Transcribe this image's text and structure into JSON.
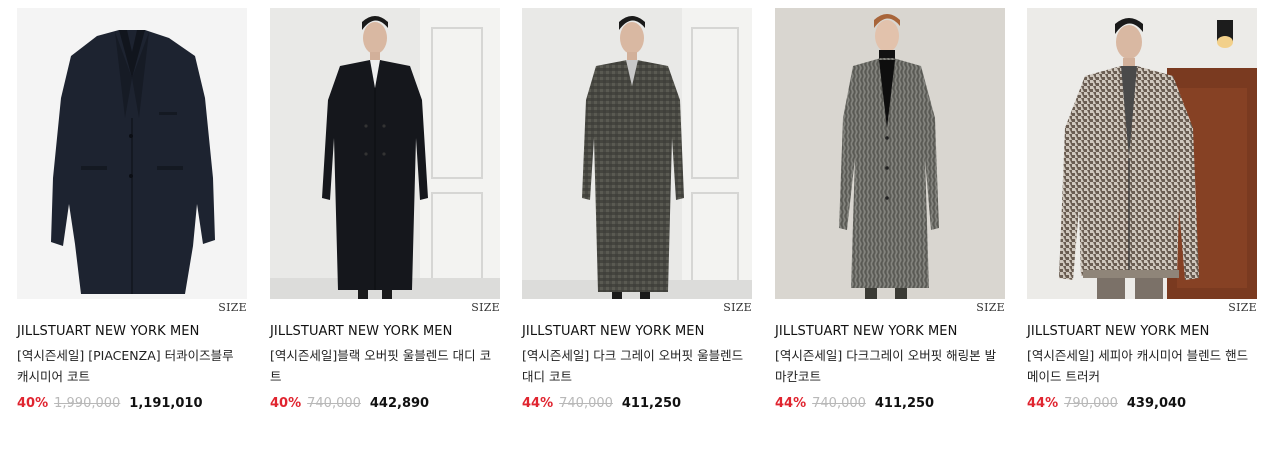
{
  "products": [
    {
      "brand": "JILLSTUART NEW YORK MEN",
      "name": "[역시즌세일] [PIACENZA] 터콰이즈블루 캐시미어 코트",
      "size_label": "SIZE",
      "discount": "40%",
      "original_price": "1,990,000",
      "sale_price": "1,191,010",
      "image": "navy-cashmere-coat-flat"
    },
    {
      "brand": "JILLSTUART NEW YORK MEN",
      "name": "[역시즌세일]블랙 오버핏 울블렌드 대디 코트",
      "size_label": "SIZE",
      "discount": "40%",
      "original_price": "740,000",
      "sale_price": "442,890",
      "image": "model-black-double-breasted-coat"
    },
    {
      "brand": "JILLSTUART NEW YORK MEN",
      "name": "[역시즌세일] 다크 그레이 오버핏 울블렌드 대디 코트",
      "size_label": "SIZE",
      "discount": "44%",
      "original_price": "740,000",
      "sale_price": "411,250",
      "image": "model-dark-grey-check-coat"
    },
    {
      "brand": "JILLSTUART NEW YORK MEN",
      "name": "[역시즌세일] 다크그레이 오버핏 해링본 발마칸코트",
      "size_label": "SIZE",
      "discount": "44%",
      "original_price": "740,000",
      "sale_price": "411,250",
      "image": "model-grey-herringbone-balmacaan"
    },
    {
      "brand": "JILLSTUART NEW YORK MEN",
      "name": "[역시즌세일] 세피아 캐시미어 블렌드 핸드메이드 트러커",
      "size_label": "SIZE",
      "discount": "44%",
      "original_price": "790,000",
      "sale_price": "439,040",
      "image": "model-houndstooth-trucker-jacket"
    }
  ],
  "colors": {
    "discount": "#e0242f",
    "original_price": "#b8b8b8",
    "text": "#111111"
  }
}
